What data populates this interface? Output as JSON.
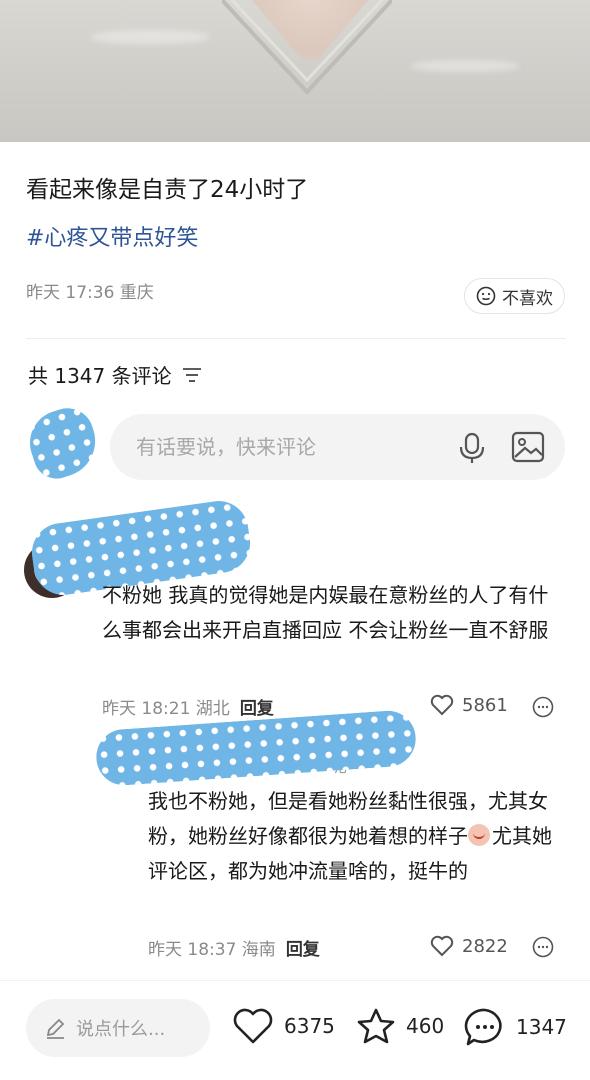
{
  "post": {
    "title": "看起来像是自责了24小时了",
    "tag": "#心疼又带点好笑",
    "meta": "昨天 17:36 重庆",
    "dislike_label": "不喜欢"
  },
  "comments_header": {
    "count_label": "共 1347 条评论"
  },
  "composer": {
    "placeholder": "有话要说，快来评论"
  },
  "comment": {
    "text": "不粉她 我真的觉得她是内娱最在意粉丝的人了有什么事都会出来开启直播回应 不会让粉丝一直不舒服",
    "meta": "昨天 18:21 湖北",
    "reply_label": "回复",
    "likes": "5861"
  },
  "reply": {
    "name_tail": "呢",
    "text_before_emoji": "我也不粉她，但是看她粉丝黏性很强，尤其女粉，她粉丝好像都很为她着想的样子",
    "text_after_emoji": "尤其她评论区，都为她冲流量啥的，挺牛的",
    "meta": "昨天 18:37 海南",
    "reply_label": "回复",
    "likes": "2822"
  },
  "bottom_bar": {
    "say_placeholder": "说点什么...",
    "likes": "6375",
    "favorites": "460",
    "comments": "1347"
  },
  "colors": {
    "tag": "#2f5597",
    "smudge": "#6fb6e6"
  },
  "icons": [
    "smile-icon",
    "filter-icon",
    "mic-icon",
    "image-icon",
    "heart-icon",
    "more-icon",
    "pencil-icon",
    "star-icon",
    "comment-icon"
  ]
}
